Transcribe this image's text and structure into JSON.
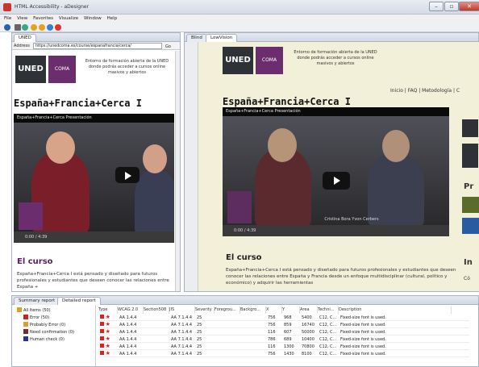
{
  "window": {
    "title": "HTML Accessibility - aDesigner"
  },
  "menu": [
    "File",
    "View",
    "Favorites",
    "Visualize",
    "Window",
    "Help"
  ],
  "left_pane": {
    "tab": "UNED",
    "address_label": "Address",
    "address_value": "https://unedcoma.es/course/espanafrancia/cerca/",
    "go_label": "Go",
    "page": {
      "logo": "UNED",
      "coma": "COMA",
      "tagline": "Entorno de formación abierta de la UNED donde podrás acceder a cursos online masivos y abiertos",
      "heading": "España+Francia+Cerca I",
      "video_title": "España+Francia+Cerca Presentación",
      "video_time": "0:00 / 4:39",
      "section_heading": "El curso",
      "paragraph": "España+Francia+Cerca I está pensado y diseñado para futuros profesionales y estudiantes que deseen conocer las relaciones entre España +"
    }
  },
  "right_pane": {
    "tabs": [
      "Blind",
      "LowVision"
    ],
    "page": {
      "logo": "UNED",
      "coma": "COMA",
      "tagline": "Entorno de formación abierta de la UNED donde podrás acceder a cursos online masivos y abiertos",
      "nav_links": "Inicio | FAQ | Metodología | C",
      "heading": "España+Francia+Cerca I",
      "video_title": "España+Francia+Cerca Presentación",
      "video_caption": "Cristina Bora Yvon Cerbers",
      "video_time": "0:00 / 4:39",
      "section_heading": "El curso",
      "paragraph": "España+Francia+Cerca I está pensado y diseñado para futuros profesionales y estudiantes que deseen conocer las relaciones entre España y Francia desde un enfoque multidisciplinar (cultural, político y económico) y adquirir las herramientas",
      "side_letters": [
        "Pr",
        "In",
        "Có"
      ]
    }
  },
  "bottom_panel": {
    "tabs": [
      "Summary report",
      "Detailed report"
    ],
    "tree": [
      {
        "label": "All Items (50)",
        "color": "#d9a321"
      },
      {
        "label": "Error (50)",
        "color": "#cc2222"
      },
      {
        "label": "Probably Error (0)",
        "color": "#d9a321"
      },
      {
        "label": "Need confirmation (0)",
        "color": "#7a2a2a"
      },
      {
        "label": "Human check (0)",
        "color": "#2233aa"
      }
    ],
    "columns": [
      "Type",
      "WCAG 2.0",
      "Section508",
      "JIS",
      "Severity",
      "Foregrou...",
      "Backgro...",
      "X",
      "Y",
      "Area",
      "Techni...",
      "Description"
    ],
    "rows": [
      {
        "wcag": "AA 1.4.4",
        "jis": "AA 7.1.4.4",
        "sev": "25",
        "x": "756",
        "y": "968",
        "area": "5400",
        "tech": "C12, C...",
        "desc": "Fixed-size font is used."
      },
      {
        "wcag": "AA 1.4.4",
        "jis": "AA 7.1.4.4",
        "sev": "25",
        "x": "756",
        "y": "859",
        "area": "16740",
        "tech": "C12, C...",
        "desc": "Fixed-size font is used."
      },
      {
        "wcag": "AA 1.4.4",
        "jis": "AA 7.1.4.4",
        "sev": "25",
        "x": "116",
        "y": "607",
        "area": "50000",
        "tech": "C12, C...",
        "desc": "Fixed-size font is used."
      },
      {
        "wcag": "AA 1.4.4",
        "jis": "AA 7.1.4.4",
        "sev": "25",
        "x": "786",
        "y": "689",
        "area": "10400",
        "tech": "C12, C...",
        "desc": "Fixed-size font is used."
      },
      {
        "wcag": "AA 1.4.4",
        "jis": "AA 7.1.4.4",
        "sev": "25",
        "x": "116",
        "y": "1300",
        "area": "70800",
        "tech": "C12, C...",
        "desc": "Fixed-size font is used."
      },
      {
        "wcag": "AA 1.4.4",
        "jis": "AA 7.1.4.4",
        "sev": "25",
        "x": "756",
        "y": "1430",
        "area": "8100",
        "tech": "C12, C...",
        "desc": "Fixed-size font is used."
      }
    ]
  }
}
